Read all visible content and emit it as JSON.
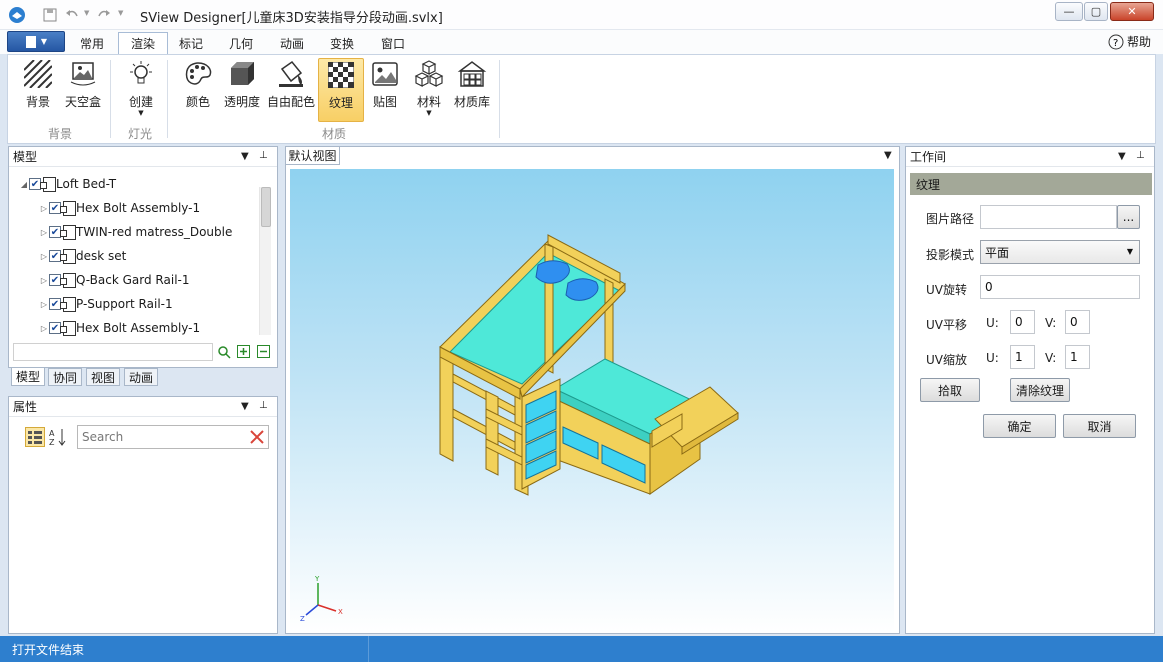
{
  "window": {
    "title": "SView Designer[儿童床3D安装指导分段动画.svlx]"
  },
  "menu_tabs": [
    {
      "label": "常用"
    },
    {
      "label": "渲染"
    },
    {
      "label": "标记"
    },
    {
      "label": "几何"
    },
    {
      "label": "动画"
    },
    {
      "label": "变换"
    },
    {
      "label": "窗口"
    }
  ],
  "help": {
    "label": "帮助"
  },
  "ribbon": {
    "buttons": {
      "background": "背景",
      "skybox": "天空盒",
      "create": "创建",
      "color": "颜色",
      "transparency": "透明度",
      "free_color": "自由配色",
      "texture": "纹理",
      "decal": "贴图",
      "material": "材料",
      "material_lib": "材质库"
    },
    "groups": {
      "background": "背景",
      "light": "灯光",
      "material": "材质"
    }
  },
  "model_panel": {
    "title": "模型",
    "tree": [
      {
        "label": "Loft Bed-T"
      },
      {
        "label": "Hex Bolt Assembly-1"
      },
      {
        "label": "TWIN-red matress_Double"
      },
      {
        "label": "desk set"
      },
      {
        "label": "Q-Back Gard Rail-1"
      },
      {
        "label": "P-Support Rail-1"
      },
      {
        "label": "Hex Bolt Assembly-1"
      }
    ],
    "tabs": [
      "模型",
      "协同",
      "视图",
      "动画"
    ]
  },
  "props_panel": {
    "title": "属性",
    "search_placeholder": "Search"
  },
  "view": {
    "tab": "默认视图"
  },
  "workspace": {
    "title": "工作间",
    "section": "纹理",
    "image_path_label": "图片路径",
    "image_path_value": "",
    "browse": "...",
    "projection_label": "投影模式",
    "projection_value": "平面",
    "uv_rotate_label": "UV旋转",
    "uv_rotate_value": "0",
    "uv_translate_label": "UV平移",
    "uv_scale_label": "UV缩放",
    "u_label": "U:",
    "v_label": "V:",
    "translate_u": "0",
    "translate_v": "0",
    "scale_u": "1",
    "scale_v": "1",
    "pick": "拾取",
    "clear": "清除纹理",
    "ok": "确定",
    "cancel": "取消"
  },
  "status": {
    "text": "打开文件结束"
  },
  "axes": {
    "x": "X",
    "y": "Y",
    "z": "Z"
  },
  "colors": {
    "accent": "#2e7fce",
    "bed_frame": "#f2d15a",
    "mattress": "#4ee8d8",
    "drawers": "#3fd3f2"
  }
}
